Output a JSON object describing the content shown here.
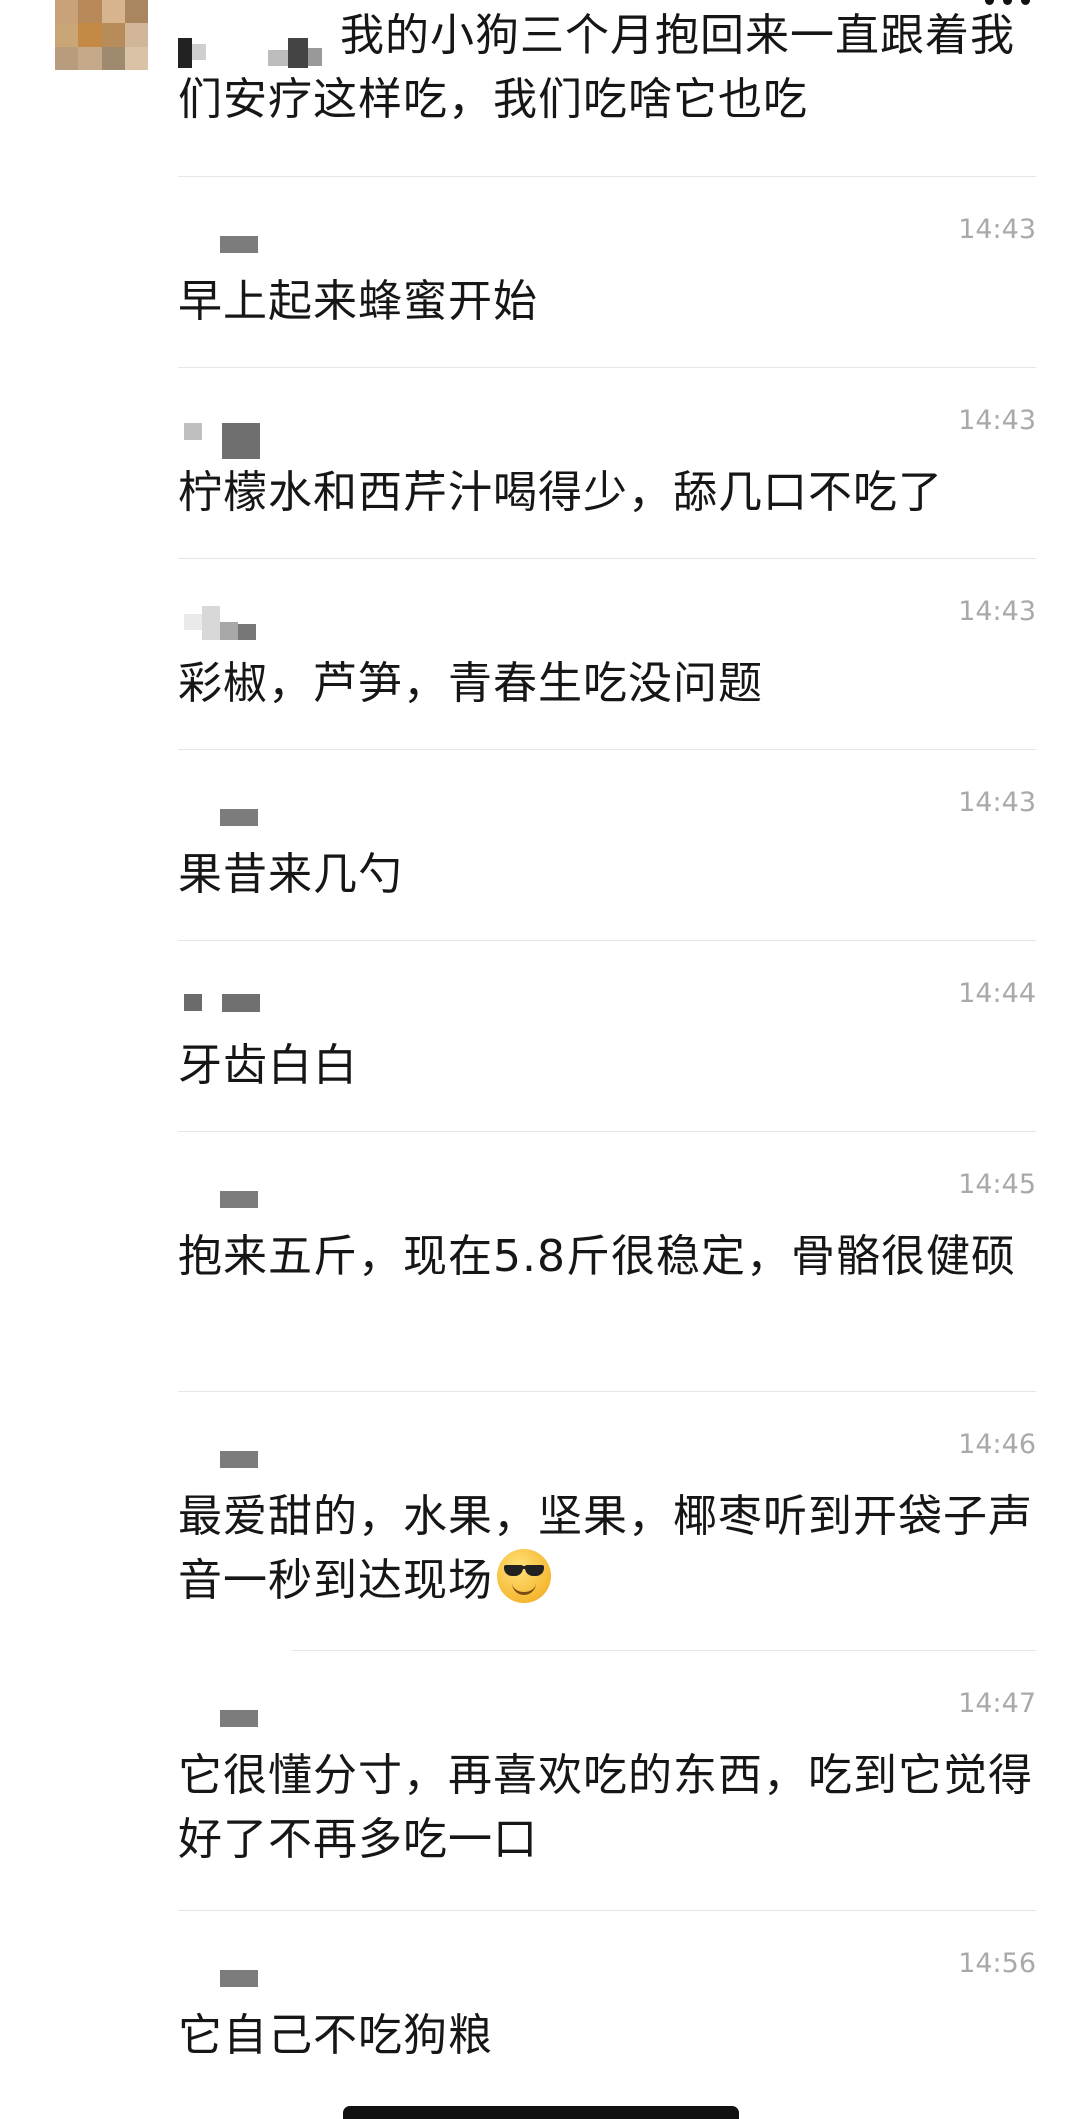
{
  "chat": {
    "top_message": {
      "text": "我的小狗三个月抱回来一直跟着我们安疗这样吃，我们吃啥它也吃"
    },
    "messages": [
      {
        "time": "14:43",
        "text": "早上起来蜂蜜开始"
      },
      {
        "time": "14:43",
        "text": "柠檬水和西芹汁喝得少，舔几口不吃了"
      },
      {
        "time": "14:43",
        "text": "彩椒，芦笋，青春生吃没问题"
      },
      {
        "time": "14:43",
        "text": "果昔来几勺"
      },
      {
        "time": "14:44",
        "text": "牙齿白白"
      },
      {
        "time": "14:45",
        "text": "抱来五斤，现在5.8斤很稳定，骨骼很健硕"
      },
      {
        "time": "14:46",
        "text": "最爱甜的，水果，坚果，椰枣听到开袋子声音一秒到达现场",
        "emoji": "sunglasses-smiling-face"
      },
      {
        "time": "14:47",
        "text": "它很懂分寸，再喜欢吃的东西，吃到它觉得好了不再多吃一口"
      },
      {
        "time": "14:56",
        "text": "它自己不吃狗粮"
      }
    ]
  },
  "colors": {
    "text": "#161616",
    "time": "#a9a9a9",
    "separator": "#e6e6e6",
    "background": "#ffffff"
  }
}
